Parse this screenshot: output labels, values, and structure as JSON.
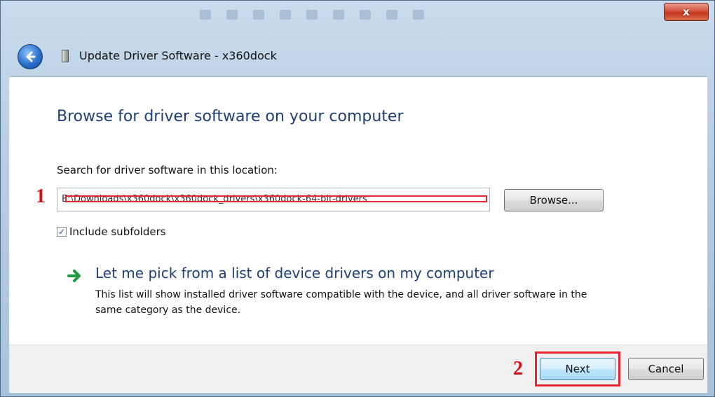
{
  "window": {
    "title": "Update Driver Software - x360dock",
    "close_glyph": "x"
  },
  "main": {
    "heading": "Browse for driver software on your computer",
    "location_label": "Search for driver software in this location:",
    "path_value": "E:\\Downloads\\x360dock\\x360dock_drivers\\x360dock-64-bit-drivers",
    "browse_label": "Browse...",
    "include_subfolders_label": "Include subfolders",
    "include_subfolders_checked": true,
    "pick_title": "Let me pick from a list of device drivers on my computer",
    "pick_description": "This list will show installed driver software compatible with the device, and all driver software in the same category as the device."
  },
  "footer": {
    "next_label": "Next",
    "cancel_label": "Cancel"
  },
  "annotations": {
    "marker_1": "1",
    "marker_2": "2",
    "color": "#e8262f"
  },
  "icons": {
    "back": "back-arrow-icon",
    "device": "device-icon",
    "pick": "green-arrow-icon",
    "check": "checkmark-icon"
  }
}
